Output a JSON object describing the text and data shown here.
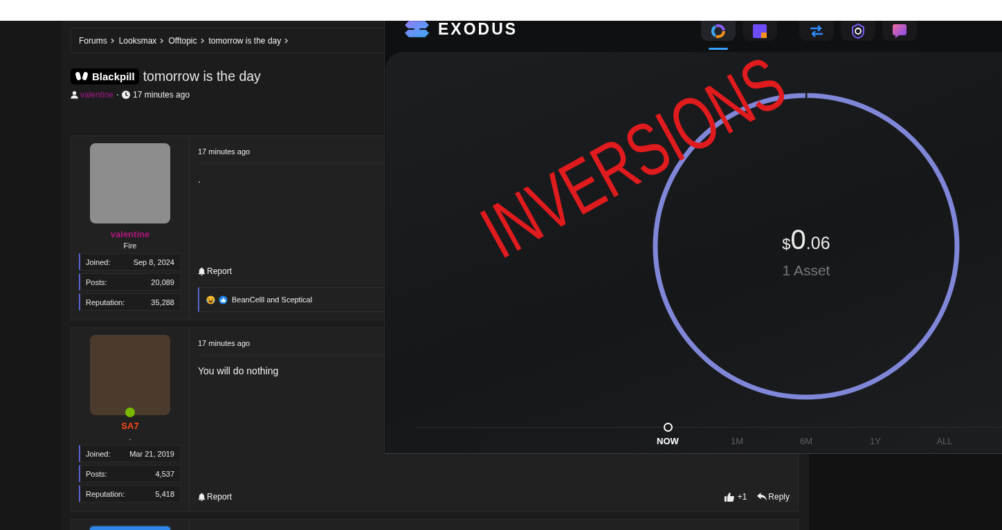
{
  "breadcrumbs": [
    "Forums",
    "Looksmax",
    "Offtopic",
    "tomorrow is the day"
  ],
  "thread": {
    "prefix": "Blackpill",
    "title": "tomorrow is the day",
    "author": "valentine",
    "time": "17 minutes ago"
  },
  "posts": [
    {
      "author": {
        "name": "valentine",
        "color": "#b0177c",
        "title": "Fire"
      },
      "stats": [
        {
          "label": "Joined:",
          "value": "Sep 8, 2024"
        },
        {
          "label": "Posts:",
          "value": "20,089"
        },
        {
          "label": "Reputation:",
          "value": "35,288"
        }
      ],
      "time": "17 minutes ago",
      "body": ".",
      "report": "Report",
      "reactions": {
        "text": "BeanCelll and Sceptical",
        "icons": [
          {
            "kind": "haha"
          },
          {
            "kind": "like"
          }
        ]
      }
    },
    {
      "author": {
        "name": "SA7",
        "color": "#ff4a1a",
        "title": ".",
        "online": true
      },
      "stats": [
        {
          "label": "Joined:",
          "value": "Mar 21, 2019"
        },
        {
          "label": "Posts:",
          "value": "4,537"
        },
        {
          "label": "Reputation:",
          "value": "5,418"
        }
      ],
      "time": "17 minutes ago",
      "body": "You will do nothing",
      "report": "Report",
      "likes": "+1",
      "reply": "Reply"
    }
  ],
  "exodus": {
    "logo": "EXODUS",
    "apps": [
      {
        "kind": "donut",
        "selected": true
      },
      {
        "kind": "square",
        "selected": false
      },
      {
        "kind": "arrows",
        "selected": false
      },
      {
        "kind": "shield",
        "selected": false
      },
      {
        "kind": "bubble",
        "selected": false
      }
    ],
    "balance": {
      "currency": "$",
      "whole": "0",
      "cents": ".06"
    },
    "assets": "1 Asset",
    "ranges": [
      {
        "label": "NOW",
        "selected": true
      },
      {
        "label": "1M",
        "selected": false
      },
      {
        "label": "6M",
        "selected": false
      },
      {
        "label": "1Y",
        "selected": false
      },
      {
        "label": "ALL",
        "selected": false
      }
    ]
  },
  "annotation": "INVERSIONS"
}
